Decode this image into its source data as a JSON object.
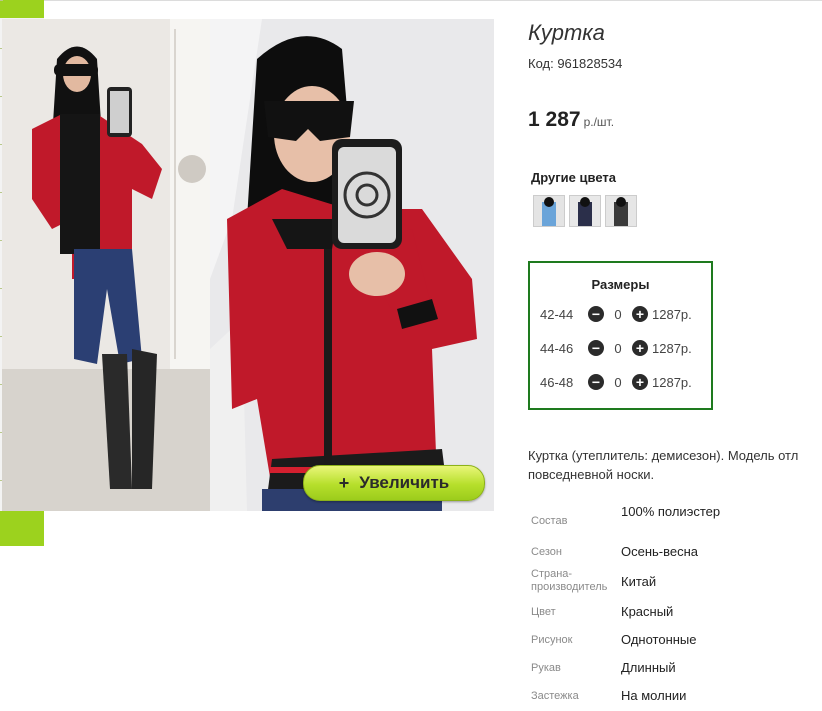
{
  "product": {
    "title": "Куртка",
    "code": "Код: 961828534",
    "price": "1 287",
    "price_unit": "р./шт."
  },
  "gallery": {
    "zoom_label": "Увеличить",
    "zoom_icon": "+"
  },
  "other_colors": {
    "title": "Другие цвета"
  },
  "sizes": {
    "title": "Размеры",
    "rows": [
      {
        "size": "42-44",
        "qty": "0",
        "price": "1287р."
      },
      {
        "size": "44-46",
        "qty": "0",
        "price": "1287р."
      },
      {
        "size": "46-48",
        "qty": "0",
        "price": "1287р."
      }
    ]
  },
  "description": {
    "line1": "Куртка (утеплитель: демисезон). Модель отл",
    "line2": "повседневной носки."
  },
  "properties": [
    {
      "key": "Состав",
      "value": "100% полиэстер"
    },
    {
      "key": "Сезон",
      "value": "Осень-весна"
    },
    {
      "key": "Страна-производитель",
      "value": "Китай"
    },
    {
      "key": "Цвет",
      "value": "Красный"
    },
    {
      "key": "Рисунок",
      "value": "Однотонные"
    },
    {
      "key": "Рукав",
      "value": "Длинный"
    },
    {
      "key": "Застежка",
      "value": "На молнии"
    }
  ],
  "colors": {
    "accent_green": "#9cd21e",
    "sizes_border": "#1e7a1e",
    "jacket_red": "#c0192a"
  }
}
